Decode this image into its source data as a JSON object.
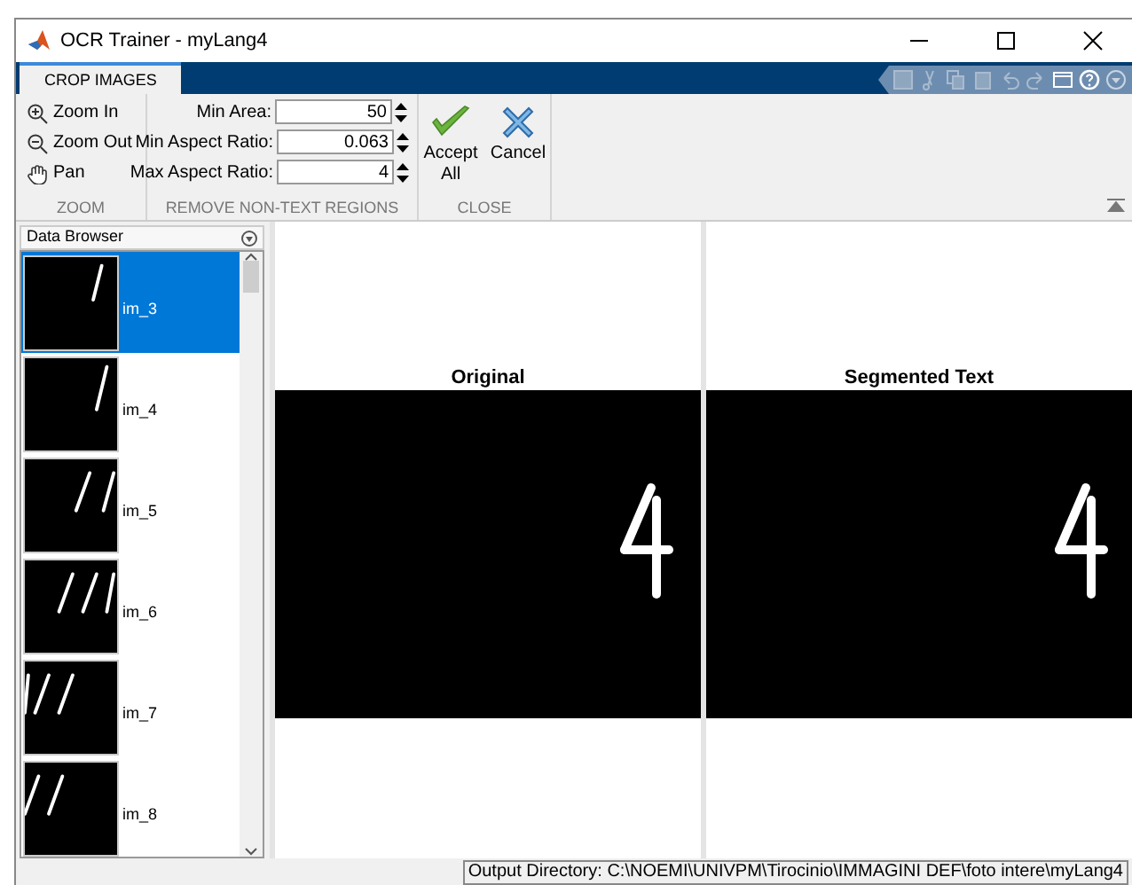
{
  "window": {
    "title": "OCR Trainer - myLang4"
  },
  "tabs": [
    {
      "label": "CROP IMAGES",
      "selected": true
    }
  ],
  "zoom_group": {
    "label": "ZOOM",
    "buttons": [
      {
        "label": "Zoom In"
      },
      {
        "label": "Zoom Out"
      },
      {
        "label": "Pan"
      }
    ]
  },
  "regions_group": {
    "label": "REMOVE NON-TEXT REGIONS",
    "fields": [
      {
        "label": "Min Area:",
        "value": "50"
      },
      {
        "label": "Min Aspect Ratio:",
        "value": "0.063"
      },
      {
        "label": "Max Aspect Ratio:",
        "value": "4"
      }
    ]
  },
  "close_group": {
    "label": "CLOSE",
    "buttons": [
      {
        "label": "Accept All"
      },
      {
        "label": "Cancel"
      }
    ]
  },
  "data_browser": {
    "title": "Data Browser",
    "items": [
      {
        "label": "im_3",
        "selected": true
      },
      {
        "label": "im_4",
        "selected": false
      },
      {
        "label": "im_5",
        "selected": false
      },
      {
        "label": "im_6",
        "selected": false
      },
      {
        "label": "im_7",
        "selected": false
      },
      {
        "label": "im_8",
        "selected": false
      }
    ]
  },
  "panels": [
    {
      "title": "Original"
    },
    {
      "title": "Segmented Text"
    }
  ],
  "status_bar": "Output Directory: C:\\NOEMI\\UNIVPM\\Tirocinio\\IMMAGINI DEF\\foto intere\\myLang4"
}
